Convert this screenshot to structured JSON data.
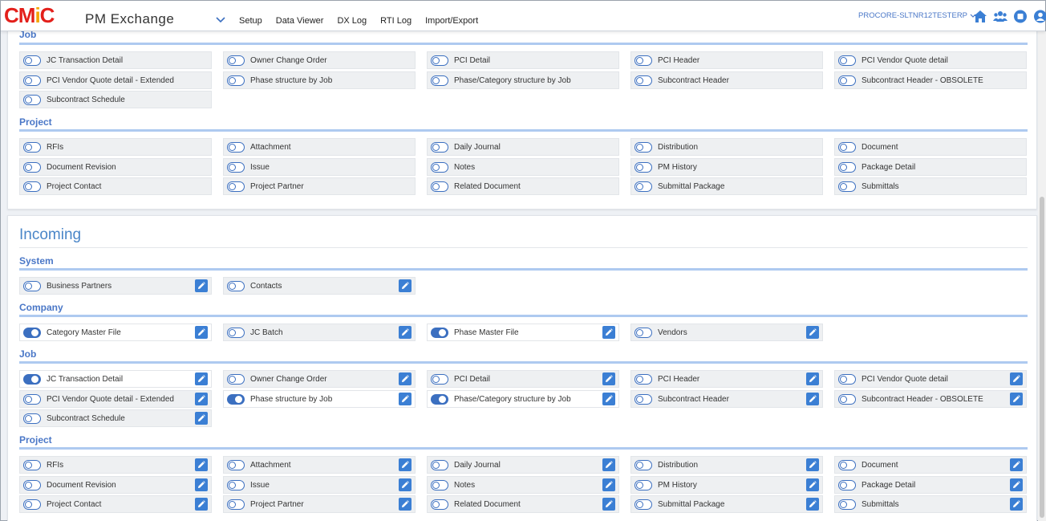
{
  "header": {
    "logo_text_1": "CM",
    "logo_text_2": "i",
    "logo_text_3": "C",
    "app_title": "PM Exchange",
    "nav": [
      "Setup",
      "Data Viewer",
      "DX Log",
      "RTI Log",
      "Import/Export"
    ],
    "org": "PROCORE-SLTNR12TESTERP",
    "icons": [
      "home-icon",
      "users-icon",
      "stop-icon",
      "user-icon"
    ]
  },
  "colors": {
    "accent": "#3b6fc0",
    "brand_red": "#e3201b",
    "brand_orange": "#f4a400",
    "section_blue": "#4a77c7"
  },
  "outgoing": {
    "sections": [
      {
        "title": "Job",
        "items": [
          {
            "label": "JC Transaction Detail",
            "on": false
          },
          {
            "label": "Owner Change Order",
            "on": false
          },
          {
            "label": "PCI Detail",
            "on": false
          },
          {
            "label": "PCI Header",
            "on": false
          },
          {
            "label": "PCI Vendor Quote detail",
            "on": false
          },
          {
            "label": "PCI Vendor Quote detail - Extended",
            "on": false
          },
          {
            "label": "Phase structure by Job",
            "on": false
          },
          {
            "label": "Phase/Category structure by Job",
            "on": false
          },
          {
            "label": "Subcontract Header",
            "on": false
          },
          {
            "label": "Subcontract Header - OBSOLETE",
            "on": false
          },
          {
            "label": "Subcontract Schedule",
            "on": false
          }
        ]
      },
      {
        "title": "Project",
        "items": [
          {
            "label": "RFIs",
            "on": false
          },
          {
            "label": "Attachment",
            "on": false
          },
          {
            "label": "Daily Journal",
            "on": false
          },
          {
            "label": "Distribution",
            "on": false
          },
          {
            "label": "Document",
            "on": false
          },
          {
            "label": "Document Revision",
            "on": false
          },
          {
            "label": "Issue",
            "on": false
          },
          {
            "label": "Notes",
            "on": false
          },
          {
            "label": "PM History",
            "on": false
          },
          {
            "label": "Package Detail",
            "on": false
          },
          {
            "label": "Project Contact",
            "on": false
          },
          {
            "label": "Project Partner",
            "on": false
          },
          {
            "label": "Related Document",
            "on": false
          },
          {
            "label": "Submittal Package",
            "on": false
          },
          {
            "label": "Submittals",
            "on": false
          }
        ]
      }
    ]
  },
  "incoming": {
    "title": "Incoming",
    "sections": [
      {
        "title": "System",
        "items": [
          {
            "label": "Business Partners",
            "on": false
          },
          {
            "label": "Contacts",
            "on": false
          }
        ]
      },
      {
        "title": "Company",
        "items": [
          {
            "label": "Category Master File",
            "on": true
          },
          {
            "label": "JC Batch",
            "on": false
          },
          {
            "label": "Phase Master File",
            "on": true
          },
          {
            "label": "Vendors",
            "on": false
          }
        ]
      },
      {
        "title": "Job",
        "items": [
          {
            "label": "JC Transaction Detail",
            "on": true
          },
          {
            "label": "Owner Change Order",
            "on": false
          },
          {
            "label": "PCI Detail",
            "on": false
          },
          {
            "label": "PCI Header",
            "on": false
          },
          {
            "label": "PCI Vendor Quote detail",
            "on": false
          },
          {
            "label": "PCI Vendor Quote detail - Extended",
            "on": false
          },
          {
            "label": "Phase structure by Job",
            "on": true
          },
          {
            "label": "Phase/Category structure by Job",
            "on": true
          },
          {
            "label": "Subcontract Header",
            "on": false
          },
          {
            "label": "Subcontract Header - OBSOLETE",
            "on": false
          },
          {
            "label": "Subcontract Schedule",
            "on": false
          }
        ]
      },
      {
        "title": "Project",
        "items": [
          {
            "label": "RFIs",
            "on": false
          },
          {
            "label": "Attachment",
            "on": false
          },
          {
            "label": "Daily Journal",
            "on": false
          },
          {
            "label": "Distribution",
            "on": false
          },
          {
            "label": "Document",
            "on": false
          },
          {
            "label": "Document Revision",
            "on": false
          },
          {
            "label": "Issue",
            "on": false
          },
          {
            "label": "Notes",
            "on": false
          },
          {
            "label": "PM History",
            "on": false
          },
          {
            "label": "Package Detail",
            "on": false
          },
          {
            "label": "Project Contact",
            "on": false
          },
          {
            "label": "Project Partner",
            "on": false
          },
          {
            "label": "Related Document",
            "on": false
          },
          {
            "label": "Submittal Package",
            "on": false
          },
          {
            "label": "Submittals",
            "on": false
          }
        ]
      }
    ]
  }
}
